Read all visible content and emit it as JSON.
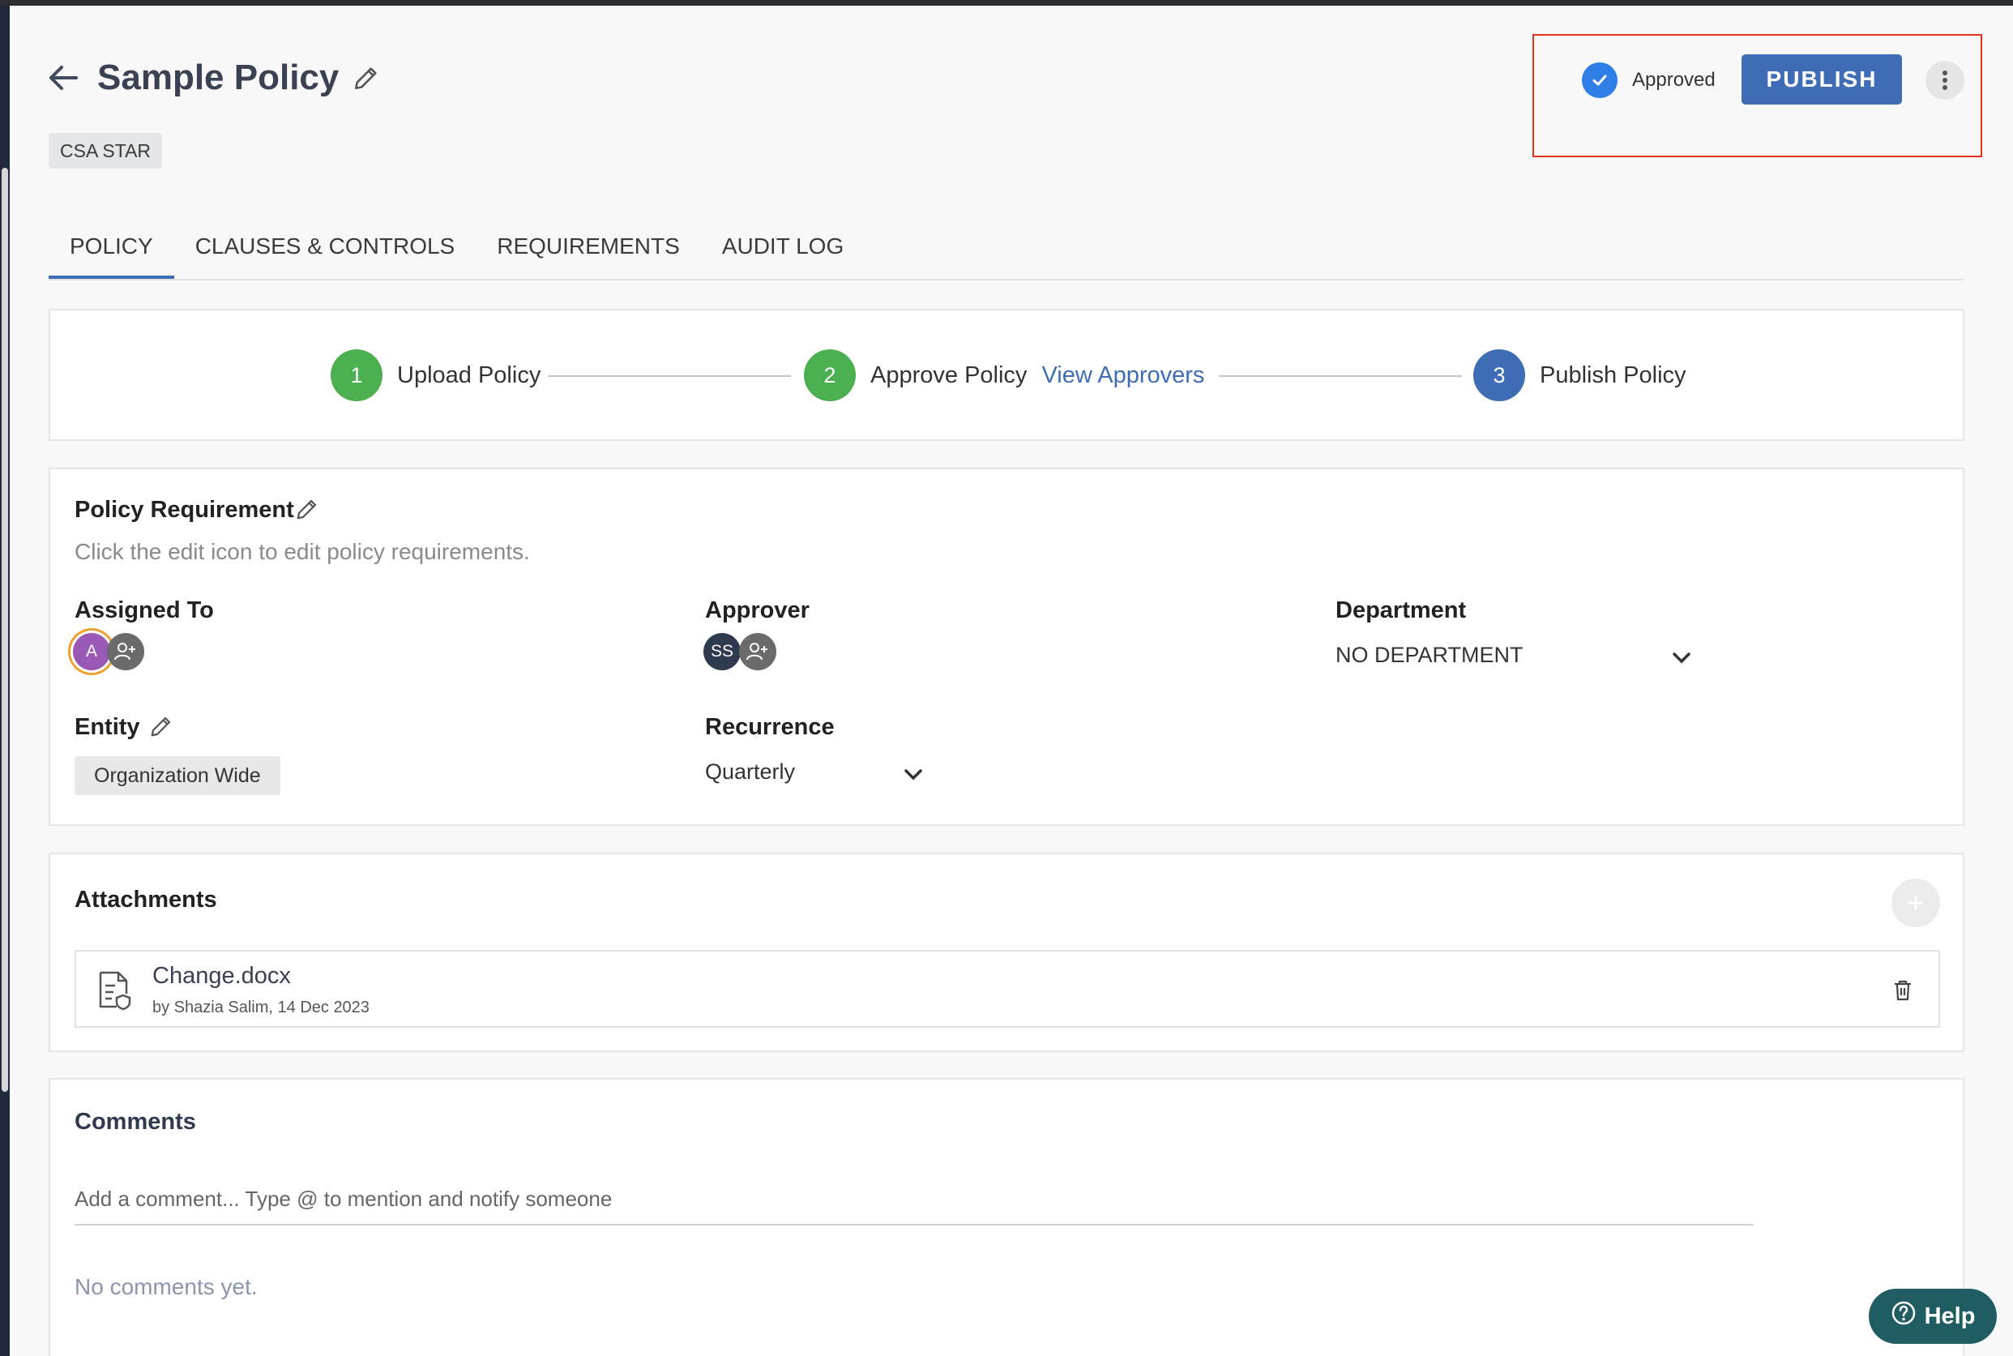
{
  "header": {
    "title": "Sample Policy",
    "tag": "CSA STAR",
    "status_label": "Approved",
    "publish_label": "PUBLISH"
  },
  "tabs": [
    {
      "label": "POLICY",
      "active": true
    },
    {
      "label": "CLAUSES & CONTROLS",
      "active": false
    },
    {
      "label": "REQUIREMENTS",
      "active": false
    },
    {
      "label": "AUDIT LOG",
      "active": false
    }
  ],
  "stepper": {
    "steps": [
      {
        "number": "1",
        "label": "Upload Policy",
        "state": "done"
      },
      {
        "number": "2",
        "label": "Approve Policy",
        "link": "View Approvers",
        "state": "done"
      },
      {
        "number": "3",
        "label": "Publish Policy",
        "state": "current"
      }
    ]
  },
  "requirement": {
    "title": "Policy Requirement",
    "hint": "Click the edit icon to edit policy requirements.",
    "assigned_to_label": "Assigned To",
    "assigned_avatar": "A",
    "approver_label": "Approver",
    "approver_avatar": "SS",
    "department_label": "Department",
    "department_value": "NO DEPARTMENT",
    "entity_label": "Entity",
    "entity_value": "Organization Wide",
    "recurrence_label": "Recurrence",
    "recurrence_value": "Quarterly"
  },
  "attachments": {
    "title": "Attachments",
    "files": [
      {
        "name": "Change.docx",
        "meta": "by Shazia Salim, 14 Dec 2023"
      }
    ]
  },
  "comments": {
    "title": "Comments",
    "placeholder": "Add a comment... Type @ to mention and notify someone",
    "empty_text": "No comments yet."
  },
  "help": {
    "label": "Help"
  },
  "colors": {
    "primary": "#3e6db6",
    "step_done": "#4caf50",
    "step_current": "#3e6db6",
    "check_blue": "#2f7ee8",
    "highlight_border": "#e0321e",
    "help_bg": "#1f5d63"
  }
}
